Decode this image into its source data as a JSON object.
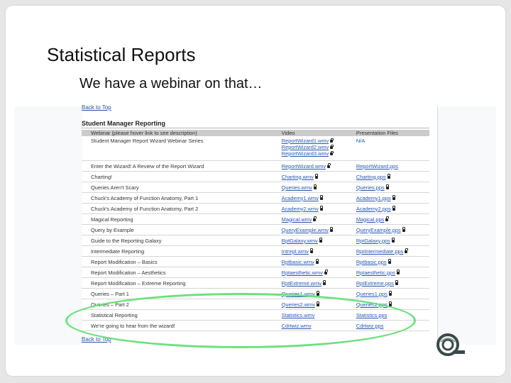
{
  "slide": {
    "title": "Statistical Reports",
    "subtitle": "We have a webinar on that…"
  },
  "screenshot": {
    "back_to_top_label": "Back to Top",
    "section_title": "Student Manager Reporting",
    "headers": [
      "Webinar (please hover link to see description)",
      "Video",
      "Presentation Files"
    ],
    "rows": [
      {
        "name": "Student Manager Report Wizard Webinar Series",
        "video": [
          "ReportWizard1.wmv",
          "ReportWizard2.wmv",
          "ReportWizard3.wmv"
        ],
        "files": "N/A",
        "files_lock": false
      },
      {
        "name": "Enter the Wizard! A Review of the Report Wizard",
        "video": [
          "ReportWizard.wmv"
        ],
        "files": "ReportWizard.pps",
        "files_lock": false
      },
      {
        "name": "Charting!",
        "video": [
          "Charting.wmv"
        ],
        "files": "Charting.pps",
        "files_lock": true
      },
      {
        "name": "Queries Aren't Scary",
        "video": [
          "Queries.wmv"
        ],
        "files": "Queries.pps",
        "files_lock": true
      },
      {
        "name": "Chuck's Academy of Function Anatomy, Part 1",
        "video": [
          "Academy1.wmv"
        ],
        "files": "Academy1.pps",
        "files_lock": true
      },
      {
        "name": "Chuck's Academy of Function Anatomy, Part 2",
        "video": [
          "Academy2.wmv"
        ],
        "files": "Academy2.pps",
        "files_lock": true
      },
      {
        "name": "Magical Reporting",
        "video": [
          "Magical.wmv"
        ],
        "files": "Magical.pps",
        "files_lock": true
      },
      {
        "name": "Query by Example",
        "video": [
          "QueryExample.wmv"
        ],
        "files": "QueryExample.pps",
        "files_lock": true
      },
      {
        "name": "Guide to the Reporting Galaxy",
        "video": [
          "RptGalaxy.wmv"
        ],
        "files": "RptGalaxy.pps",
        "files_lock": true
      },
      {
        "name": "Intermediate Reporting",
        "video": [
          "Intrept.wmv"
        ],
        "files": "RptIntermediate.pps",
        "files_lock": true
      },
      {
        "name": "Report Modification – Basics",
        "video": [
          "Rptbasic.wmv"
        ],
        "files": "Rptbasic.pps",
        "files_lock": true
      },
      {
        "name": "Report Modification – Aesthetics",
        "video": [
          "Rptaesthetic.wmv"
        ],
        "files": "Rptaesthetic.pps",
        "files_lock": true
      },
      {
        "name": "Report Modification – Extreme Reporting",
        "video": [
          "RptExtreme.wmv"
        ],
        "files": "RptExtreme.pps",
        "files_lock": true
      },
      {
        "name": "Queries – Part 1",
        "video": [
          "Queries1.wmv"
        ],
        "files": "Queries1.pps",
        "files_lock": true
      },
      {
        "name": "Queries – Part 2",
        "video": [
          "Queries2.wmv"
        ],
        "files": "Queries2.pps",
        "files_lock": true
      },
      {
        "name": "Statistical Reporting",
        "video": [
          "Statistics.wmv"
        ],
        "files": "Statistics.pps",
        "files_lock": false
      },
      {
        "name": "We're going to hear from the wizard!",
        "video": [
          "Cdrtwiz.wmv"
        ],
        "files": "Cdrtwiz.pps",
        "files_lock": false
      }
    ],
    "video_locks": [
      [
        true,
        true,
        true
      ],
      [
        true
      ],
      [
        true
      ],
      [
        true
      ],
      [
        true
      ],
      [
        true
      ],
      [
        true
      ],
      [
        true
      ],
      [
        true
      ],
      [
        true
      ],
      [
        true
      ],
      [
        true
      ],
      [
        true
      ],
      [
        true
      ],
      [
        true
      ],
      [
        false
      ],
      [
        false
      ]
    ]
  },
  "colors": {
    "highlight": "#6ee07e",
    "link": "#2457b0",
    "header_bg": "#cbcbcb"
  },
  "icons": [
    "lock-icon",
    "logo-icon"
  ]
}
